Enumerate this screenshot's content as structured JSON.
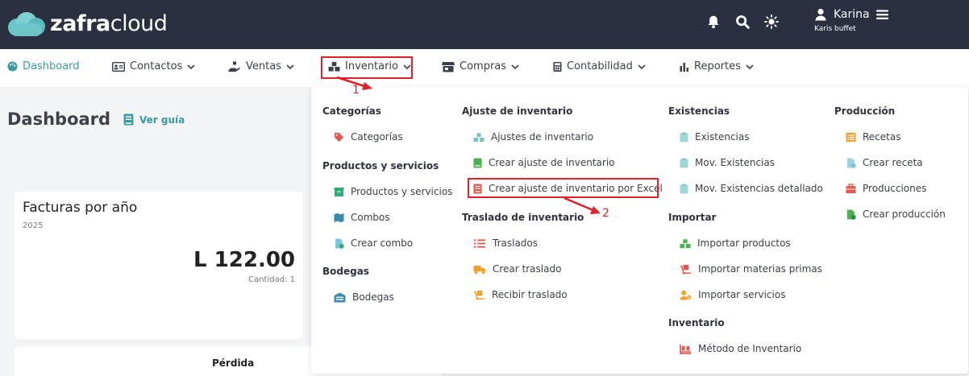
{
  "header": {
    "logo_bold": "zafra",
    "logo_light": "cloud",
    "user_name": "Karina",
    "user_company": "Karis buffet",
    "icons": [
      "bell-icon",
      "search-icon",
      "sun-icon",
      "user-icon",
      "menu-icon"
    ]
  },
  "nav": {
    "dashboard": "Dashboard",
    "contactos": "Contactos",
    "ventas": "Ventas",
    "inventario": "Inventario",
    "compras": "Compras",
    "contabilidad": "Contabilidad",
    "reportes": "Reportes"
  },
  "page": {
    "title": "Dashboard",
    "guide": "Ver guía"
  },
  "card_invoices": {
    "title": "Facturas por año",
    "year": "2025",
    "amount": "L 122.00",
    "quantity": "Cantidad: 1"
  },
  "card_loss": {
    "title": "Pérdida"
  },
  "dropdown": {
    "categorias_head": "Categorías",
    "categorias": "Categorías",
    "productos_head": "Productos y servicios",
    "productos": "Productos y servicios",
    "combos": "Combos",
    "crear_combo": "Crear combo",
    "bodegas_head": "Bodegas",
    "bodegas": "Bodegas",
    "ajuste_head": "Ajuste de inventario",
    "ajustes": "Ajustes de inventario",
    "crear_ajuste": "Crear ajuste de inventario",
    "crear_ajuste_excel": "Crear ajuste de inventario por Excel",
    "traslado_head": "Traslado de inventario",
    "traslados": "Traslados",
    "crear_traslado": "Crear traslado",
    "recibir_traslado": "Recibir traslado",
    "existencias_head": "Existencias",
    "existencias": "Existencias",
    "mov_existencias": "Mov. Existencias",
    "mov_existencias_det": "Mov. Existencias detallado",
    "importar_head": "Importar",
    "importar_productos": "Importar productos",
    "importar_materias": "Importar materias primas",
    "importar_servicios": "Importar servicios",
    "inventario_head": "Inventario",
    "metodo_inventario": "Método de Inventario",
    "produccion_head": "Producción",
    "recetas": "Recetas",
    "crear_receta": "Crear receta",
    "producciones": "Producciones",
    "crear_produccion": "Crear producción"
  },
  "annotations": {
    "step1": "1",
    "step2": "2"
  },
  "colors": {
    "topbar": "#2b3040",
    "accent": "#3a9aa0",
    "annotation": "#e0202a"
  }
}
